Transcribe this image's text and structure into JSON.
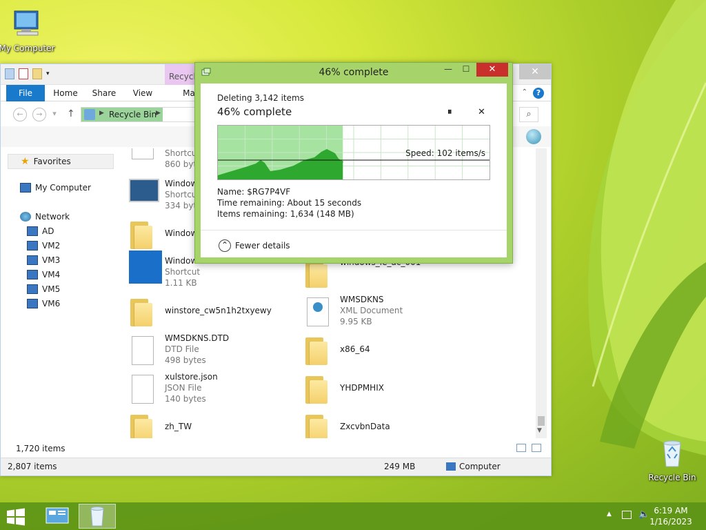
{
  "desktop": {
    "icons": [
      {
        "label": "My Computer"
      },
      {
        "label": "Recycle Bin"
      }
    ]
  },
  "explorer": {
    "context_tab": "Recycle",
    "close_label": "✕",
    "tabs": [
      "File",
      "Home",
      "Share",
      "View",
      "Ma"
    ],
    "help": "?",
    "address": {
      "segment": "Recycle Bin"
    },
    "search_icon": "⌕",
    "sidebar": {
      "favorites": "Favorites",
      "my_computer": "My Computer",
      "network": "Network",
      "network_items": [
        "AD",
        "VM2",
        "VM3",
        "VM4",
        "VM5",
        "VM6"
      ]
    },
    "files": [
      {
        "name": "Shortcut",
        "type": "860 bytes",
        "kind": "shortcut-partial"
      },
      {
        "name": "Windows",
        "type": "Shortcut",
        "size": "334 bytes",
        "kind": "shortcut-app"
      },
      {
        "name": "Windows",
        "kind": "folder"
      },
      {
        "name": "Windows",
        "type": "Shortcut",
        "size": "1.11 KB",
        "kind": "shortcut-shield"
      },
      {
        "name": "winstore_cw5n1h2txyewy",
        "kind": "folder"
      },
      {
        "name": "WMSDKNS.DTD",
        "type": "DTD File",
        "size": "498 bytes",
        "kind": "doc"
      },
      {
        "name": "xulstore.json",
        "type": "JSON File",
        "size": "140 bytes",
        "kind": "doc"
      },
      {
        "name": "zh_TW",
        "kind": "folder"
      },
      {
        "name": "windows_ie_ac_001",
        "kind": "folder"
      },
      {
        "name": "WMSDKNS",
        "type": "XML Document",
        "size": "9.95 KB",
        "kind": "xml"
      },
      {
        "name": "x86_64",
        "kind": "folder"
      },
      {
        "name": "YHDPMHIX",
        "kind": "folder"
      },
      {
        "name": "ZxcvbnData",
        "kind": "folder"
      }
    ],
    "status_items": "1,720 items",
    "bottom": {
      "items": "2,807 items",
      "size": "249 MB",
      "location": "Computer"
    }
  },
  "dialog": {
    "title": "46% complete",
    "operation": "Deleting 3,142 items",
    "progress_label": "46% complete",
    "progress_fraction": 0.46,
    "pause": "⏸",
    "cancel": "✕",
    "speed": "Speed: 102 items/s",
    "name_label": "Name:",
    "name_value": "$RG7P4VF",
    "time_label": "Time remaining:",
    "time_value": "About 15 seconds",
    "items_label": "Items remaining:",
    "items_value": "1,634 (148 MB)",
    "fewer_details": "Fewer details",
    "min": "—",
    "max": "☐",
    "close": "✕",
    "accent": "#a7d46a",
    "fill_color": "#2ea82e"
  },
  "taskbar": {
    "time": "6:19 AM",
    "date": "1/16/2023"
  }
}
